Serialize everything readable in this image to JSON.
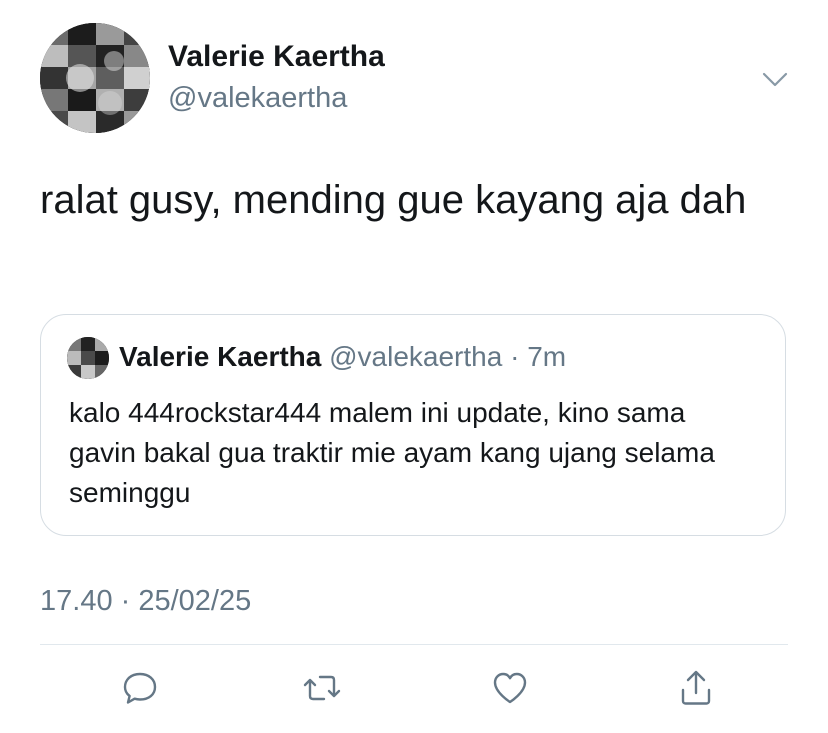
{
  "tweet": {
    "author": {
      "name": "Valerie Kaertha",
      "handle": "@valekaertha"
    },
    "text": "ralat gusy, mending gue kayang aja dah",
    "quoted": {
      "name": "Valerie Kaertha",
      "handle": "@valekaertha",
      "separator": " · ",
      "time": "7m",
      "text": "kalo 444rockstar444 malem ini update, kino sama gavin bakal gua traktir mie ayam kang ujang selama seminggu"
    },
    "timestamp": "17.40 · 25/02/25"
  },
  "icons": {
    "more": "chevron-down-icon",
    "reply": "reply-icon",
    "retweet": "retweet-icon",
    "like": "heart-icon",
    "share": "share-icon"
  },
  "colors": {
    "text": "#14171a",
    "secondary": "#657786",
    "border": "#d6dde3"
  }
}
